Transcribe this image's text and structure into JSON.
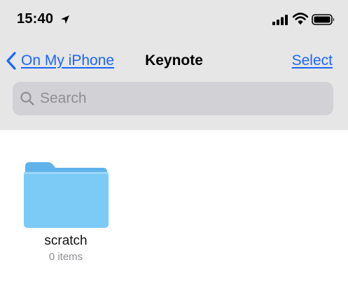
{
  "status_bar": {
    "time": "15:40",
    "icons": [
      "location-arrow-icon",
      "signal-bars-icon",
      "wifi-icon",
      "battery-icon"
    ]
  },
  "nav": {
    "back_label": "On My iPhone",
    "title": "Keynote",
    "select_label": "Select"
  },
  "search": {
    "placeholder": "Search"
  },
  "folders": [
    {
      "name": "scratch",
      "item_count": "0 items"
    }
  ],
  "colors": {
    "accent": "#1a66ff",
    "header_bg": "#e6e6e6",
    "search_bg": "#d1d1d6",
    "folder": "#76c8f5"
  }
}
